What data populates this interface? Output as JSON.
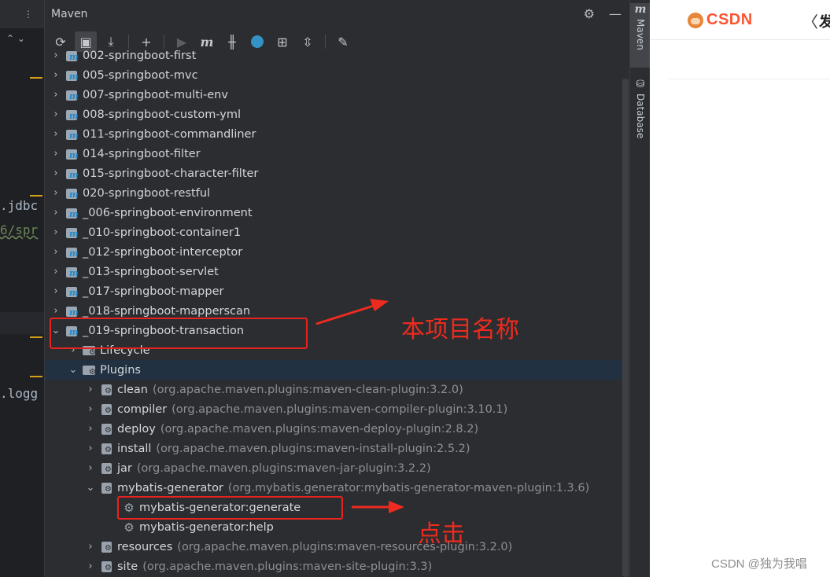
{
  "editor": {
    "code_lines": [
      {
        "text": ".jdbc",
        "color": "#a9b7c6"
      },
      {
        "text": "6/spr",
        "color": "#6a8759"
      },
      {
        "text": ".logg",
        "color": "#a9b7c6"
      }
    ]
  },
  "maven_panel": {
    "title": "Maven",
    "toolbar": [
      {
        "icon": "reload-icon",
        "glyph": "⟳"
      },
      {
        "icon": "add-folder-icon",
        "glyph": "▣"
      },
      {
        "icon": "download-icon",
        "glyph": "⤓"
      },
      {
        "icon": "add-icon",
        "glyph": "+"
      },
      {
        "icon": "run-icon",
        "glyph": "▶"
      },
      {
        "icon": "execute-goal-icon",
        "glyph": "m"
      },
      {
        "icon": "toggle-offline-icon",
        "glyph": "╫"
      },
      {
        "icon": "skip-tests-icon",
        "glyph": "●"
      },
      {
        "icon": "show-dependencies-icon",
        "glyph": "⊞"
      },
      {
        "icon": "collapse-all-icon",
        "glyph": "⇳"
      },
      {
        "icon": "settings-wrench-icon",
        "glyph": "🔧"
      }
    ]
  },
  "projects": [
    "002-springboot-first",
    "005-springboot-mvc",
    "007-springboot-multi-env",
    "008-springboot-custom-yml",
    "011-springboot-commandliner",
    "014-springboot-filter",
    "015-springboot-character-filter",
    "020-springboot-restful",
    "_006-springboot-environment",
    "_010-springboot-container1",
    "_012-springboot-interceptor",
    "_013-springboot-servlet",
    "_017-springboot-mapper",
    "_018-springboot-mapperscan"
  ],
  "current_project": "_019-springboot-transaction",
  "lifecycle_label": "Lifecycle",
  "plugins_label": "Plugins",
  "plugins": [
    {
      "name": "clean",
      "desc": "(org.apache.maven.plugins:maven-clean-plugin:3.2.0)"
    },
    {
      "name": "compiler",
      "desc": "(org.apache.maven.plugins:maven-compiler-plugin:3.10.1)"
    },
    {
      "name": "deploy",
      "desc": "(org.apache.maven.plugins:maven-deploy-plugin:2.8.2)"
    },
    {
      "name": "install",
      "desc": "(org.apache.maven.plugins:maven-install-plugin:2.5.2)"
    },
    {
      "name": "jar",
      "desc": "(org.apache.maven.plugins:maven-jar-plugin:3.2.2)"
    },
    {
      "name": "mybatis-generator",
      "desc": "(org.mybatis.generator:mybatis-generator-maven-plugin:1.3.6)"
    },
    {
      "name": "resources",
      "desc": "(org.apache.maven.plugins:maven-resources-plugin:3.2.0)"
    },
    {
      "name": "site",
      "desc": "(org.apache.maven.plugins:maven-site-plugin:3.3)"
    }
  ],
  "goals": [
    "mybatis-generator:generate",
    "mybatis-generator:help"
  ],
  "side_tabs": {
    "maven": "Maven",
    "database": "Database"
  },
  "browser": {
    "logo_text": "CSDN",
    "back_glyph": "〈",
    "publish_char": "发"
  },
  "annotations": {
    "project_note": "本项目名称",
    "click_note": "点击"
  },
  "watermark": "CSDN @独为我唱",
  "colors": {
    "highlight_box": "#e8231f",
    "note": "#ee2b1f",
    "selection": "#2e436e"
  }
}
